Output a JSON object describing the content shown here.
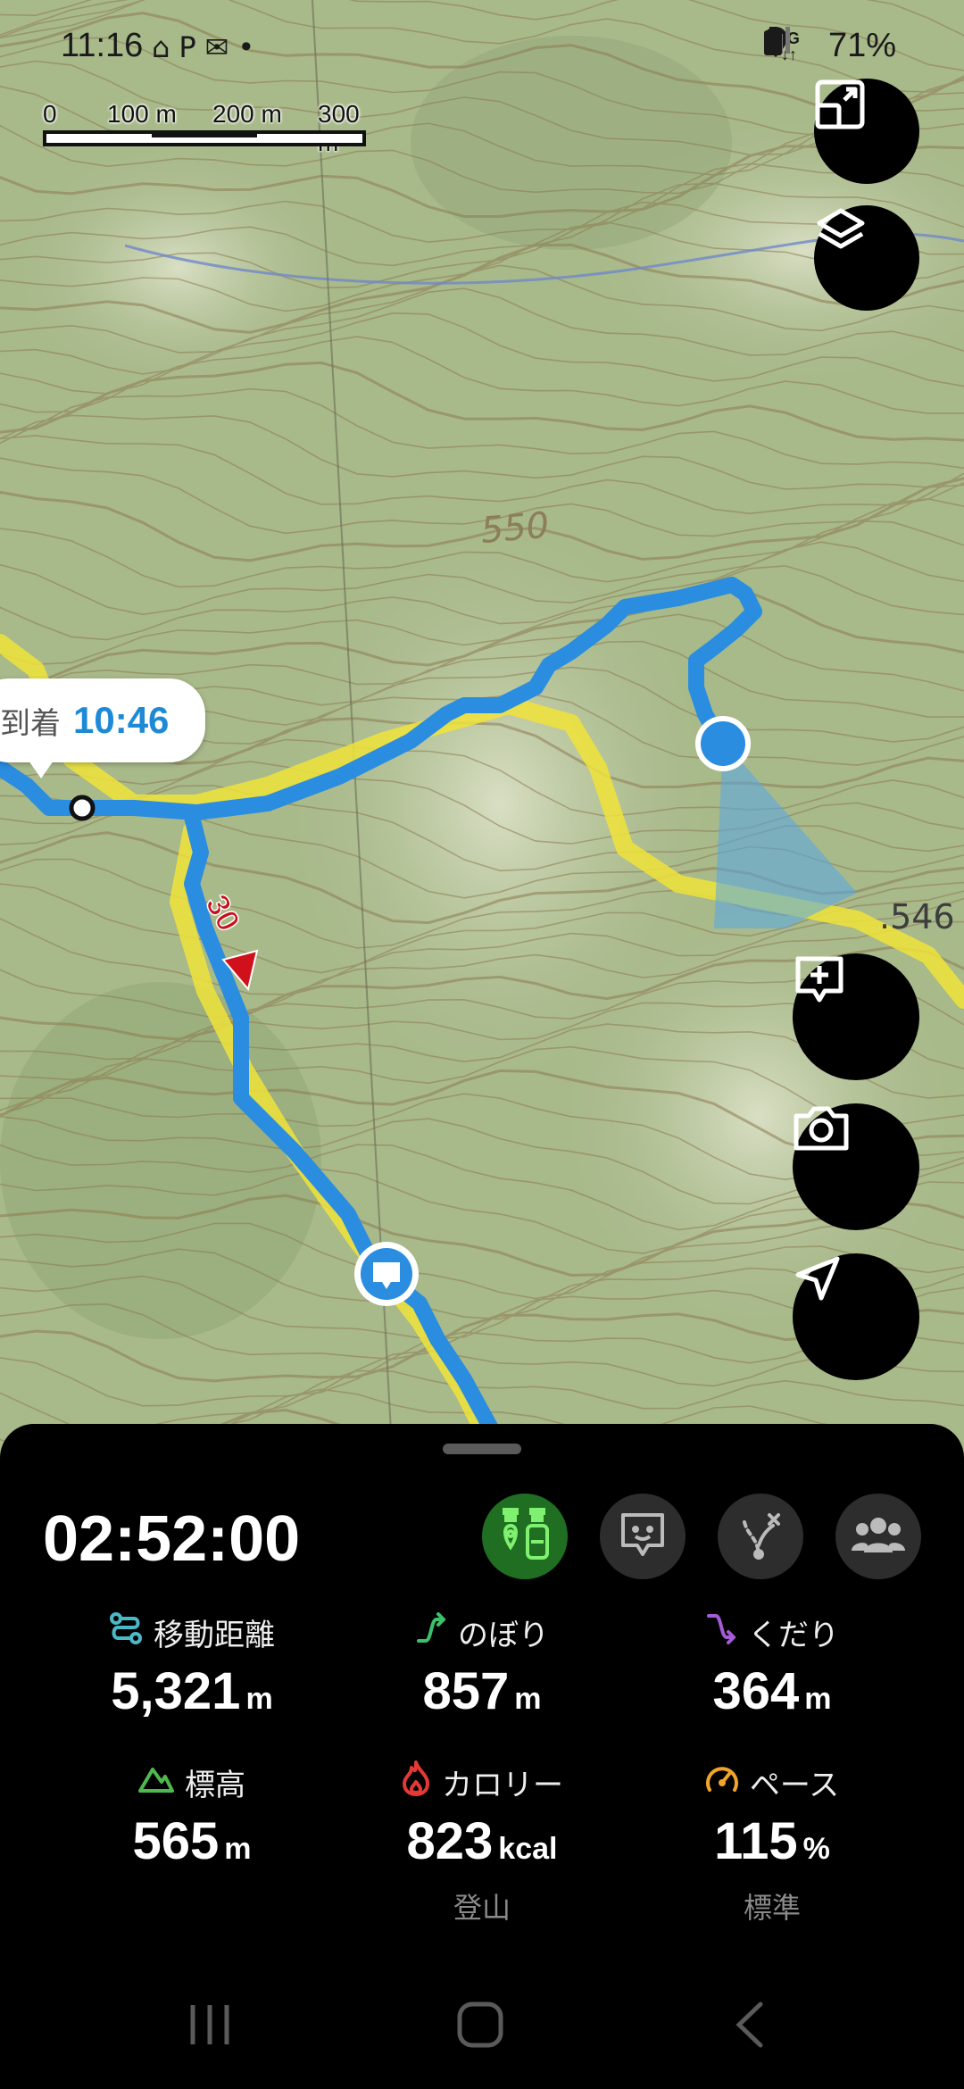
{
  "status_bar": {
    "time": "11:16",
    "left_icons": [
      "home-icon",
      "paypay-icon",
      "mail-icon",
      "dot-icon"
    ],
    "network": "5G",
    "battery": "71%"
  },
  "scale": {
    "labels": [
      "0",
      "100 m",
      "200 m",
      "300 m"
    ]
  },
  "map": {
    "contour_label": "550",
    "elevation_point_label": ".546",
    "route_marker_label": "30",
    "arrival_bubble": {
      "label": "到着",
      "time": "10:46"
    },
    "colors": {
      "route": "#2a8de0",
      "trail": "#f0e33a",
      "position": "#2a8de0",
      "warning_marker": "#d0101a"
    }
  },
  "map_buttons": [
    "expand-map-icon",
    "layers-icon",
    "add-note-icon",
    "camera-icon",
    "navigate-icon"
  ],
  "panel": {
    "elapsed_time": "02:52:00",
    "toolbar": [
      "crowd-tracker-icon",
      "memo-icon",
      "route-change-icon",
      "group-icon"
    ],
    "stats": [
      {
        "icon": "distance-icon",
        "label": "移動距離",
        "value": "5,321",
        "unit": "m",
        "sub": ""
      },
      {
        "icon": "ascent-icon",
        "label": "のぼり",
        "value": "857",
        "unit": "m",
        "sub": ""
      },
      {
        "icon": "descent-icon",
        "label": "くだり",
        "value": "364",
        "unit": "m",
        "sub": ""
      },
      {
        "icon": "elevation-icon",
        "label": "標高",
        "value": "565",
        "unit": "m",
        "sub": ""
      },
      {
        "icon": "calorie-icon",
        "label": "カロリー",
        "value": "823",
        "unit": "kcal",
        "sub": "登山"
      },
      {
        "icon": "pace-icon",
        "label": "ペース",
        "value": "115",
        "unit": "%",
        "sub": "標準"
      }
    ],
    "accent_colors": {
      "distance": "#4bb8c8",
      "ascent": "#3cc06a",
      "descent": "#a65bd6",
      "elevation": "#4fb84f",
      "calorie": "#e53935",
      "pace": "#f0a52a"
    }
  },
  "nav_bar": [
    "recent-apps-icon",
    "home-button-icon",
    "back-icon"
  ]
}
